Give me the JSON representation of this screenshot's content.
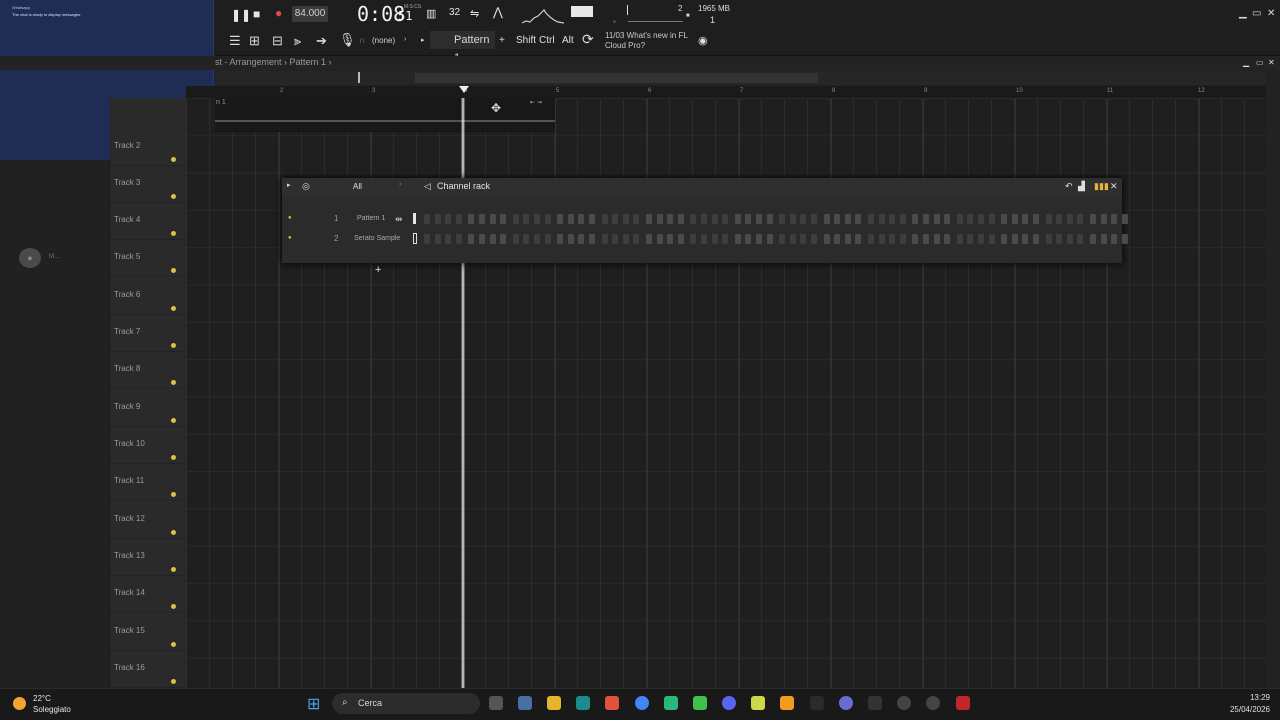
{
  "transport": {
    "tempo": "84.000",
    "time_main": "0:08",
    "time_sub": "51",
    "time_mode": "M:S:CS",
    "memory": "1965 MB",
    "memory_sub": "1",
    "cpu_value": "2"
  },
  "toolbar": {
    "none_label": "(none)",
    "pattern_label": "Pattern 1",
    "shift_label": "Shift",
    "ctrl_label": "Ctrl",
    "alt_label": "Alt",
    "news_date": "11/03",
    "news_text": "What's new in FL",
    "news_text2": "Cloud Pro?"
  },
  "notification": {
    "line1": "Whatsapp",
    "line2": "The chat is ready to display messages."
  },
  "playlist": {
    "breadcrumb": "st - Arrangement › Pattern 1 ›",
    "clip_label": "n 1",
    "ruler": [
      "2",
      "3",
      "4",
      "5",
      "6",
      "7",
      "8",
      "9",
      "10",
      "11",
      "12"
    ],
    "tracks": [
      "Track 2",
      "Track 3",
      "Track 4",
      "Track 5",
      "Track 6",
      "Track 7",
      "Track 8",
      "Track 9",
      "Track 10",
      "Track 11",
      "Track 12",
      "Track 13",
      "Track 14",
      "Track 15",
      "Track 16"
    ]
  },
  "sidebar": {
    "avatar_label": "M..."
  },
  "channel_rack": {
    "title": "Channel rack",
    "filter": "All",
    "channels": [
      {
        "num": "1",
        "name": "Pattern 1"
      },
      {
        "num": "2",
        "name": "Serato Sample"
      }
    ]
  },
  "taskbar": {
    "temperature": "22°C",
    "weather": "Soleggiato",
    "search_placeholder": "Cerca",
    "time": "13:29",
    "date": "25/04/2026"
  }
}
